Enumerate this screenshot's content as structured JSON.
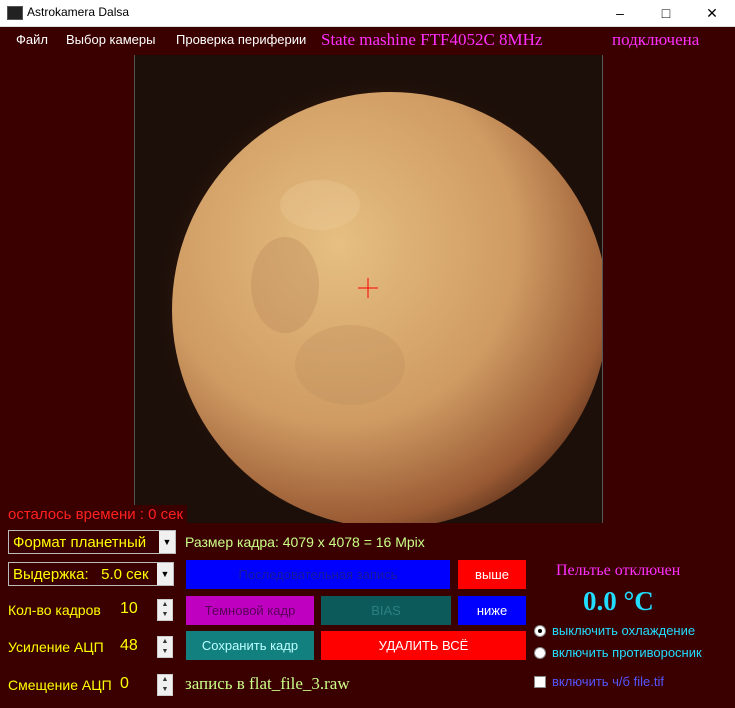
{
  "window": {
    "title": "Astrokamera Dalsa"
  },
  "menu": [
    "Файл",
    "Выбор камеры",
    "Проверка периферии"
  ],
  "status": {
    "state": "State mashine FTF4052C 8MHz",
    "connection": "подключена"
  },
  "remaining_time": "осталось времени : 0 сек",
  "format_select": "Формат планетный",
  "exposure_select": "Выдержка:   5.0 сек",
  "frames": {
    "label": "Кол-во кадров",
    "value": "10"
  },
  "gain": {
    "label": "Усиление АЦП",
    "value": "48"
  },
  "offset": {
    "label": "Смещение АЦП",
    "value": "0"
  },
  "frame_size": "Размер кадра: 4079 x 4078 = 16 Mpix",
  "buttons": {
    "sequence": "Последовательная запись",
    "higher": "выше",
    "dark": "Темновой кадр",
    "bias": "BIAS",
    "lower": "ниже",
    "save": "Сохранить кадр",
    "delete_all": "УДАЛИТЬ ВСЁ"
  },
  "recording": "запись в flat_file_3.raw",
  "peltier": {
    "status": "Пельтье отключен",
    "temperature": "0.0 °C"
  },
  "options": {
    "cooling_off": "выключить охлаждение",
    "anti_fog_on": "включить противоросник",
    "bw_tif": "включить ч/б file.tif"
  },
  "colors": {
    "background": "#3a0000",
    "accent_magenta": "#ff30ff",
    "accent_cyan": "#22ddff",
    "text_yellow": "#ffff00"
  }
}
